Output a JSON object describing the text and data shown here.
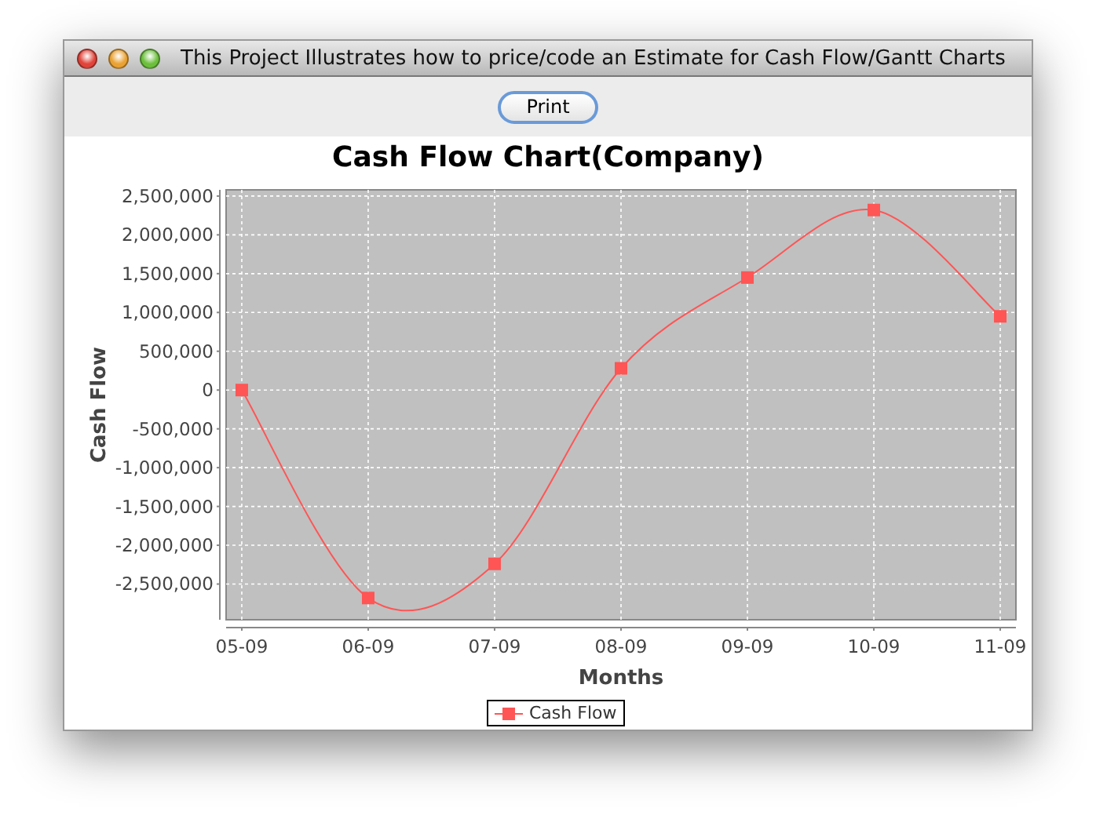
{
  "window": {
    "title": "This Project Illustrates how to price/code an Estimate for Cash Flow/Gantt Charts"
  },
  "toolbar": {
    "buttons": [
      "Print"
    ]
  },
  "chart": {
    "title": "Cash Flow Chart(Company)",
    "chart_data": {
      "type": "line",
      "xlabel": "Months",
      "ylabel": "Cash Flow",
      "categories": [
        "05-09",
        "06-09",
        "07-09",
        "08-09",
        "09-09",
        "10-09",
        "11-09"
      ],
      "grid": true,
      "series": [
        {
          "name": "Cash Flow",
          "color": "#ff5555",
          "marker": "square",
          "values": [
            0,
            -2680000,
            -2240000,
            280000,
            1450000,
            2320000,
            950000
          ]
        }
      ],
      "ylim": [
        -2960000,
        2580000
      ],
      "yticks": [
        {
          "value": 2500000,
          "label": "2,500,000"
        },
        {
          "value": 2000000,
          "label": "2,000,000"
        },
        {
          "value": 1500000,
          "label": "1,500,000"
        },
        {
          "value": 1000000,
          "label": "1,000,000"
        },
        {
          "value": 500000,
          "label": "500,000"
        },
        {
          "value": 0,
          "label": "0"
        },
        {
          "value": -500000,
          "label": "-500,000"
        },
        {
          "value": -1000000,
          "label": "-1,000,000"
        },
        {
          "value": -1500000,
          "label": "-1,500,000"
        },
        {
          "value": -2000000,
          "label": "-2,000,000"
        },
        {
          "value": -2500000,
          "label": "-2,500,000"
        }
      ]
    }
  }
}
